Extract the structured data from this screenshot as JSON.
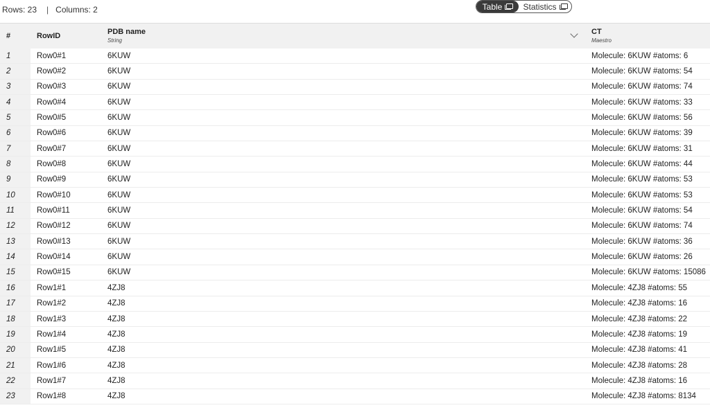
{
  "info": {
    "rows": "Rows: 23",
    "separator": "|",
    "columns": "Columns: 2"
  },
  "view_toggle": {
    "table_label": "Table",
    "statistics_label": "Statistics",
    "selected": "Table"
  },
  "columns": {
    "index": {
      "label": "#"
    },
    "rowid": {
      "label": "RowID"
    },
    "pdb": {
      "label": "PDB name",
      "type": "String"
    },
    "ct": {
      "label": "CT",
      "type": "Maestro"
    }
  },
  "rows": [
    {
      "index": "1",
      "rowid": "Row0#1",
      "pdb": "6KUW",
      "ct": "Molecule: 6KUW #atoms: 6"
    },
    {
      "index": "2",
      "rowid": "Row0#2",
      "pdb": "6KUW",
      "ct": "Molecule: 6KUW #atoms: 54"
    },
    {
      "index": "3",
      "rowid": "Row0#3",
      "pdb": "6KUW",
      "ct": "Molecule: 6KUW #atoms: 74"
    },
    {
      "index": "4",
      "rowid": "Row0#4",
      "pdb": "6KUW",
      "ct": "Molecule: 6KUW #atoms: 33"
    },
    {
      "index": "5",
      "rowid": "Row0#5",
      "pdb": "6KUW",
      "ct": "Molecule: 6KUW #atoms: 56"
    },
    {
      "index": "6",
      "rowid": "Row0#6",
      "pdb": "6KUW",
      "ct": "Molecule: 6KUW #atoms: 39"
    },
    {
      "index": "7",
      "rowid": "Row0#7",
      "pdb": "6KUW",
      "ct": "Molecule: 6KUW #atoms: 31"
    },
    {
      "index": "8",
      "rowid": "Row0#8",
      "pdb": "6KUW",
      "ct": "Molecule: 6KUW #atoms: 44"
    },
    {
      "index": "9",
      "rowid": "Row0#9",
      "pdb": "6KUW",
      "ct": "Molecule: 6KUW #atoms: 53"
    },
    {
      "index": "10",
      "rowid": "Row0#10",
      "pdb": "6KUW",
      "ct": "Molecule: 6KUW #atoms: 53"
    },
    {
      "index": "11",
      "rowid": "Row0#11",
      "pdb": "6KUW",
      "ct": "Molecule: 6KUW #atoms: 54"
    },
    {
      "index": "12",
      "rowid": "Row0#12",
      "pdb": "6KUW",
      "ct": "Molecule: 6KUW #atoms: 74"
    },
    {
      "index": "13",
      "rowid": "Row0#13",
      "pdb": "6KUW",
      "ct": "Molecule: 6KUW #atoms: 36"
    },
    {
      "index": "14",
      "rowid": "Row0#14",
      "pdb": "6KUW",
      "ct": "Molecule: 6KUW #atoms: 26"
    },
    {
      "index": "15",
      "rowid": "Row0#15",
      "pdb": "6KUW",
      "ct": "Molecule: 6KUW #atoms: 15086"
    },
    {
      "index": "16",
      "rowid": "Row1#1",
      "pdb": "4ZJ8",
      "ct": "Molecule: 4ZJ8 #atoms: 55"
    },
    {
      "index": "17",
      "rowid": "Row1#2",
      "pdb": "4ZJ8",
      "ct": "Molecule: 4ZJ8 #atoms: 16"
    },
    {
      "index": "18",
      "rowid": "Row1#3",
      "pdb": "4ZJ8",
      "ct": "Molecule: 4ZJ8 #atoms: 22"
    },
    {
      "index": "19",
      "rowid": "Row1#4",
      "pdb": "4ZJ8",
      "ct": "Molecule: 4ZJ8 #atoms: 19"
    },
    {
      "index": "20",
      "rowid": "Row1#5",
      "pdb": "4ZJ8",
      "ct": "Molecule: 4ZJ8 #atoms: 41"
    },
    {
      "index": "21",
      "rowid": "Row1#6",
      "pdb": "4ZJ8",
      "ct": "Molecule: 4ZJ8 #atoms: 28"
    },
    {
      "index": "22",
      "rowid": "Row1#7",
      "pdb": "4ZJ8",
      "ct": "Molecule: 4ZJ8 #atoms: 16"
    },
    {
      "index": "23",
      "rowid": "Row1#8",
      "pdb": "4ZJ8",
      "ct": "Molecule: 4ZJ8 #atoms: 8134"
    }
  ],
  "colors": {
    "header_bg": "#f1f1f1",
    "toggle_active_bg": "#3a3a3a",
    "row_border": "#ececec"
  }
}
